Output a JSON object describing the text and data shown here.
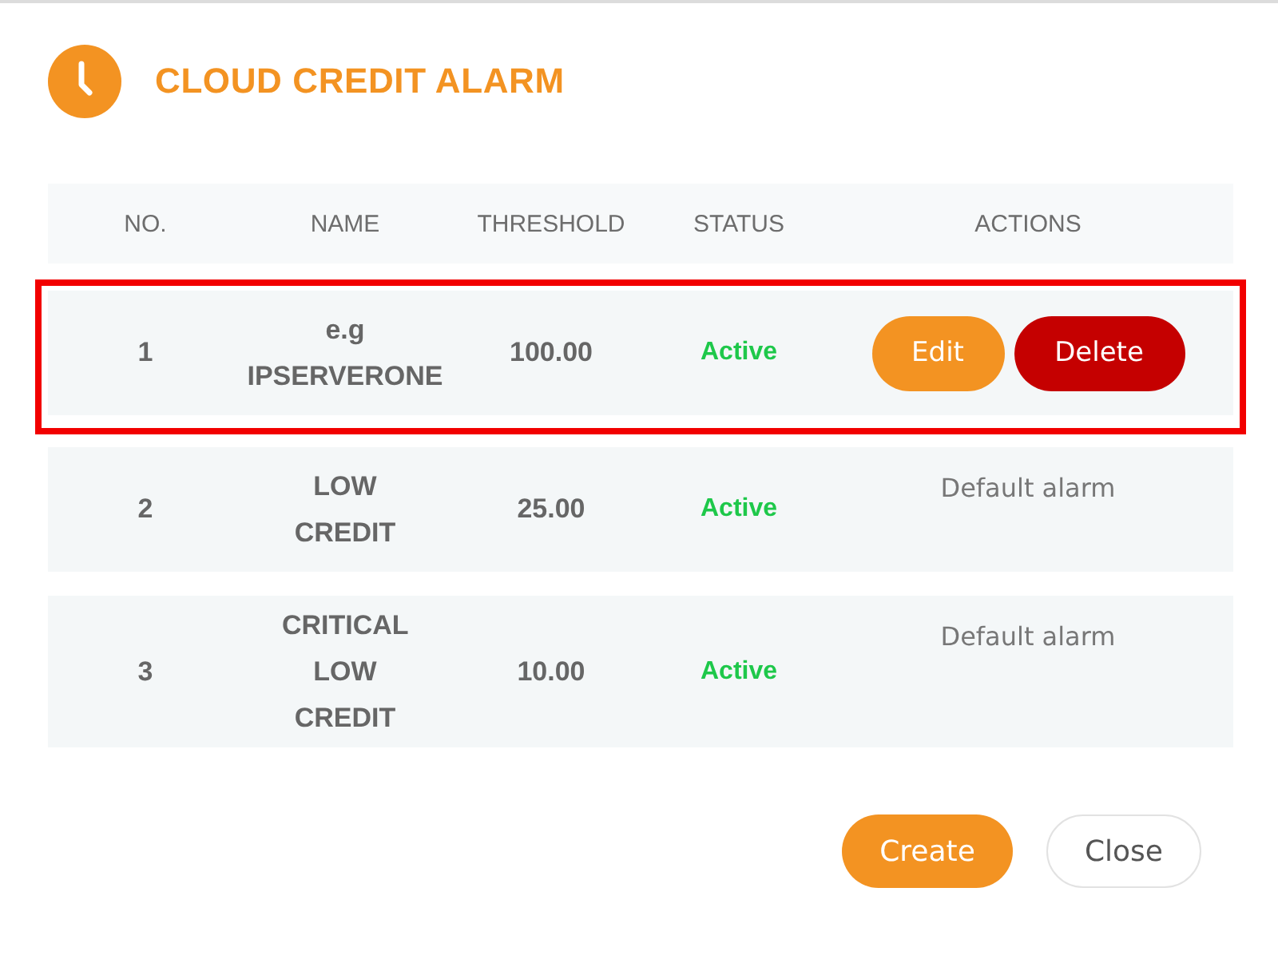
{
  "dialog": {
    "title": "CLOUD CREDIT ALARM"
  },
  "table": {
    "columns": [
      "NO.",
      "NAME",
      "THRESHOLD",
      "STATUS",
      "ACTIONS"
    ],
    "rows": [
      {
        "no": "1",
        "name": "e.g IPSERVERONE",
        "threshold": "100.00",
        "status": "Active",
        "highlighted": true,
        "actions": {
          "kind": "buttons",
          "buttons": [
            {
              "label": "Edit",
              "kind": "edit"
            },
            {
              "label": "Delete",
              "kind": "delete"
            }
          ]
        }
      },
      {
        "no": "2",
        "name": "LOW CREDIT",
        "threshold": "25.00",
        "status": "Active",
        "highlighted": false,
        "actions": {
          "kind": "note",
          "text": "Default alarm"
        }
      },
      {
        "no": "3",
        "name": "CRITICAL LOW CREDIT",
        "threshold": "10.00",
        "status": "Active",
        "highlighted": false,
        "actions": {
          "kind": "note",
          "text": "Default alarm"
        }
      }
    ]
  },
  "footer_buttons": [
    {
      "label": "Create",
      "kind": "primary"
    },
    {
      "label": "Close",
      "kind": "secondary"
    }
  ]
}
